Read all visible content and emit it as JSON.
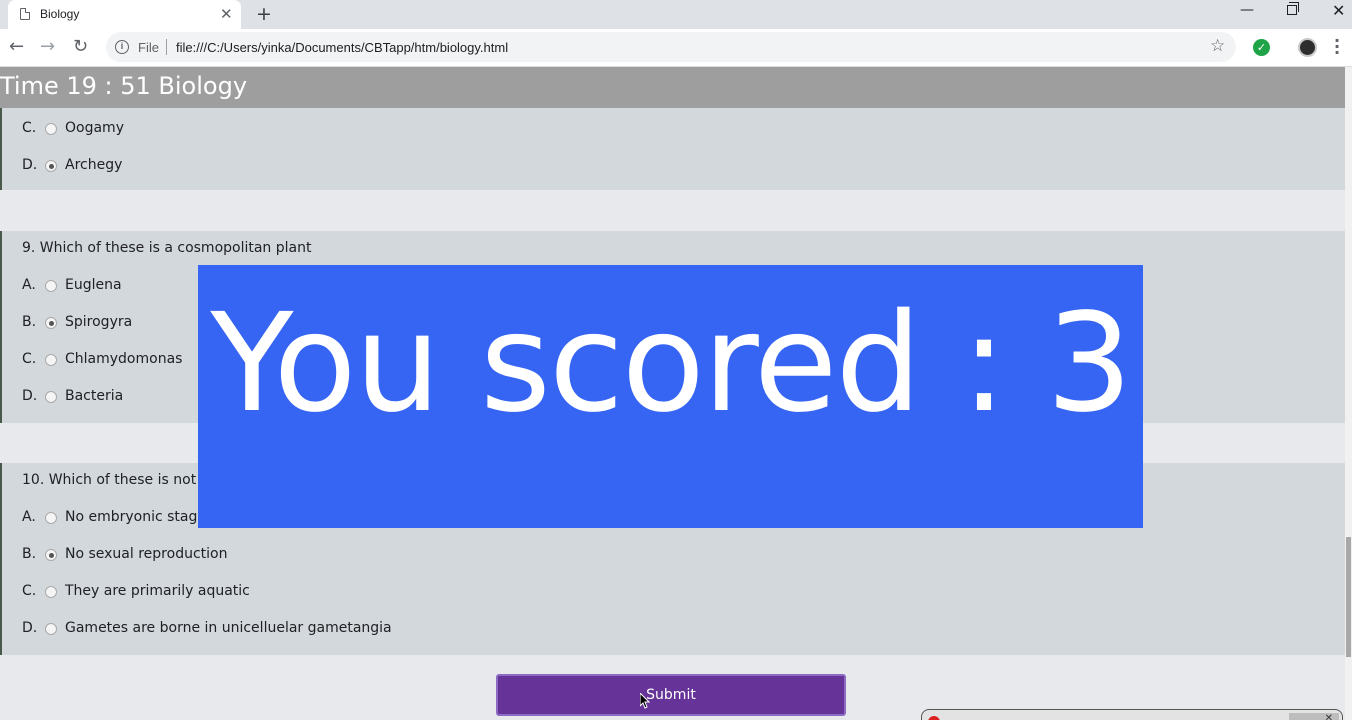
{
  "browser": {
    "tab_title": "Biology",
    "file_chip": "File",
    "url": "file:///C:/Users/yinka/Documents/CBTapp/htm/biology.html"
  },
  "header": {
    "timer_label": "Time 19 : 51 Biology"
  },
  "questions": [
    {
      "text": "",
      "options": [
        {
          "letter": "C.",
          "text": "Oogamy",
          "selected": false
        },
        {
          "letter": "D.",
          "text": "Archegy",
          "selected": true
        }
      ]
    },
    {
      "text": "9. Which of these is a cosmopolitan plant",
      "options": [
        {
          "letter": "A.",
          "text": "Euglena",
          "selected": false
        },
        {
          "letter": "B.",
          "text": "Spirogyra",
          "selected": true
        },
        {
          "letter": "C.",
          "text": "Chlamydomonas",
          "selected": false
        },
        {
          "letter": "D.",
          "text": "Bacteria",
          "selected": false
        }
      ]
    },
    {
      "text": "10. Which of these is not",
      "options": [
        {
          "letter": "A.",
          "text": "No embryonic stag",
          "selected": false
        },
        {
          "letter": "B.",
          "text": "No sexual reproduction",
          "selected": true
        },
        {
          "letter": "C.",
          "text": "They are primarily aquatic",
          "selected": false
        },
        {
          "letter": "D.",
          "text": "Gametes are borne in unicelluelar gametangia",
          "selected": false
        }
      ]
    }
  ],
  "submit_label": "Submit",
  "score": {
    "label": "You scored : 3",
    "value": 3
  },
  "colors": {
    "accent_purple": "#663399",
    "score_blue": "#3665f3",
    "header_gray": "#9e9e9e"
  }
}
